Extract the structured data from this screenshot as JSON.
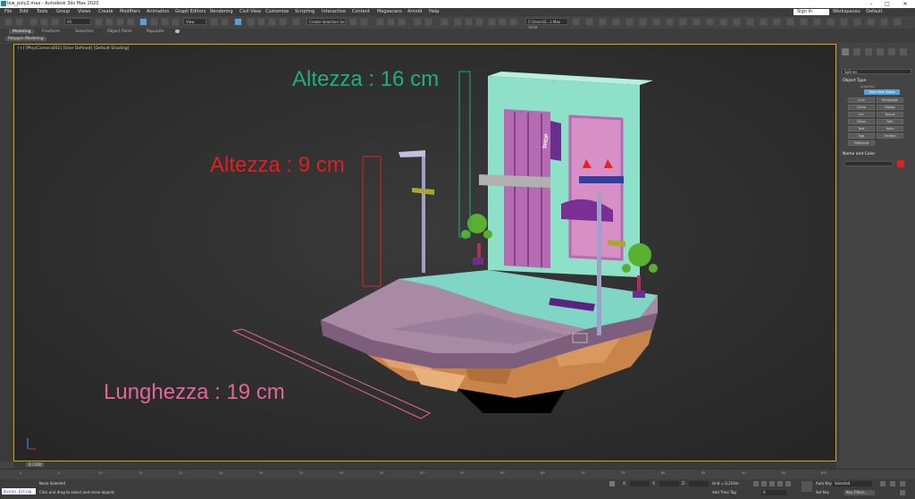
{
  "window": {
    "title": "low_poly2.max - Autodesk 3ds Max 2020",
    "controls": [
      "–",
      "□",
      "✕"
    ]
  },
  "menu": [
    "File",
    "Edit",
    "Tools",
    "Group",
    "Views",
    "Create",
    "Modifiers",
    "Animation",
    "Graph Editors",
    "Rendering",
    "Civil View",
    "Customize",
    "Scripting",
    "Interactive",
    "Content",
    "Megascans",
    "Arnold",
    "Help"
  ],
  "signin": "Sign In",
  "workspace": {
    "label": "Workspaces:",
    "value": "Default"
  },
  "toolbar": {
    "selection_filter": "All",
    "ref_coord": "View",
    "selection_set": "Create Selection Se",
    "path": "C:\\Users\\S...s Max 2020"
  },
  "ribbon": {
    "tabs": [
      "Modeling",
      "Freeform",
      "Selection",
      "Object Paint",
      "Populate"
    ],
    "sub": "Polygon Modeling"
  },
  "viewport": {
    "label": "[+] [PhysCamera002] [User Defined] [Default Shading]",
    "annotations": {
      "height_back": "Altezza : 16 cm",
      "height_front": "Altezza : 9 cm",
      "length": "Lunghezza : 19 cm",
      "shop_sign": "SHOP"
    },
    "colors": {
      "height_back": "#1fae7c",
      "height_front": "#e01f1f",
      "length": "#e2669a",
      "border": "#d4a500"
    }
  },
  "command_panel": {
    "category": "Splines",
    "rollout_object_type": "Object Type",
    "autogrid": "AutoGrid",
    "start_new_shape": "Start New Shape",
    "buttons": [
      "Line",
      "Rectangle",
      "Circle",
      "Ellipse",
      "Arc",
      "Donut",
      "NGon",
      "Star",
      "Text",
      "Helix",
      "Egg",
      "Section",
      "Freehand"
    ],
    "rollout_name_color": "Name and Color",
    "accent": "#e01f1f"
  },
  "timeline": {
    "frame": "0 / 100",
    "ticks": [
      "0",
      "5",
      "10",
      "15",
      "20",
      "25",
      "30",
      "35",
      "40",
      "45",
      "50",
      "55",
      "60",
      "65",
      "70",
      "75",
      "80",
      "85",
      "90",
      "95",
      "100"
    ]
  },
  "status": {
    "maxscript": "Quinni Estinp",
    "selection": "None Selected",
    "prompt": "Click and drag to select and move objects",
    "x_label": "X:",
    "y_label": "Y:",
    "z_label": "Z:",
    "grid": "Grid = 0,254m",
    "add_time_tag": "Add Time Tag",
    "auto_key": "Auto Key",
    "set_key": "Set Key",
    "selected": "Selected",
    "key_filters": "Key Filters...",
    "frame_value": "0"
  }
}
